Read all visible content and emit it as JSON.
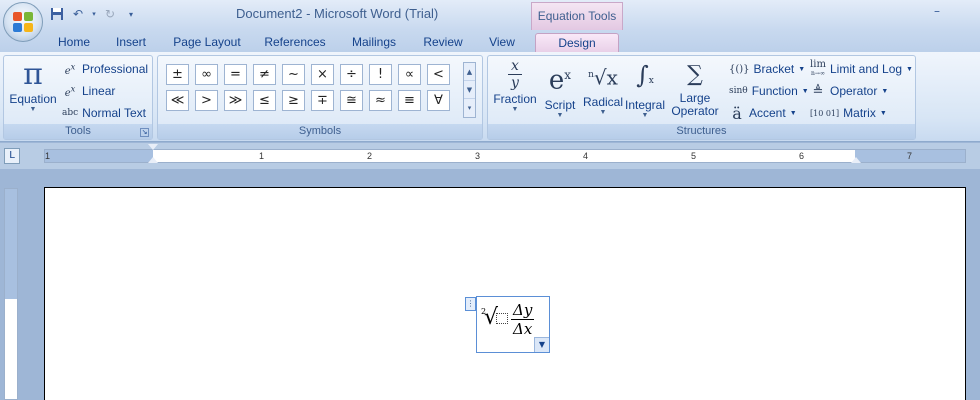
{
  "window": {
    "title": "Document2 - Microsoft Word (Trial)",
    "context_tab_group": "Equation Tools",
    "controls": {
      "minimize": "–"
    }
  },
  "quick_access": [
    "save-icon",
    "undo-icon",
    "redo-icon",
    "customize-icon"
  ],
  "tabs": [
    {
      "label": "Home"
    },
    {
      "label": "Insert"
    },
    {
      "label": "Page Layout"
    },
    {
      "label": "References"
    },
    {
      "label": "Mailings"
    },
    {
      "label": "Review"
    },
    {
      "label": "View"
    },
    {
      "label": "Design",
      "active": true
    }
  ],
  "ribbon": {
    "tools": {
      "label": "Tools",
      "equation": {
        "icon": "π",
        "label": "Equation"
      },
      "professional": "Professional",
      "linear": "Linear",
      "normal_text": "Normal Text",
      "normal_text_icon": "abc"
    },
    "symbols": {
      "label": "Symbols",
      "items": [
        "±",
        "∞",
        "=",
        "≠",
        "~",
        "×",
        "÷",
        "!",
        "∝",
        "<",
        "≪",
        ">",
        "≫",
        "≤",
        "≥",
        "∓",
        "≅",
        "≈",
        "≡",
        "∀"
      ]
    },
    "structures": {
      "label": "Structures",
      "fraction": "Fraction",
      "script": "Script",
      "radical": "Radical",
      "integral": "Integral",
      "large_operator": "Large Operator",
      "bracket": "Bracket",
      "function": "Function",
      "accent": "Accent",
      "limit_and_log": "Limit and Log",
      "operator": "Operator",
      "matrix": "Matrix",
      "bracket_icon": "{()}",
      "function_icon": "sinθ",
      "accent_icon": "ä",
      "limit_icon": "lim",
      "limit_sub": "n→∞",
      "operator_icon": "≜",
      "matrix_icon": "[10 01]"
    }
  },
  "ruler": {
    "labels": [
      "1",
      "1",
      "2",
      "3",
      "4",
      "5",
      "6",
      "7"
    ]
  },
  "equation": {
    "index": "2",
    "numerator": "Δy",
    "denominator": "Δx"
  },
  "colors": {
    "ribbon_text": "#15428b",
    "context_tab": "#e3c8e2",
    "equation_border": "#5b8fd6"
  }
}
